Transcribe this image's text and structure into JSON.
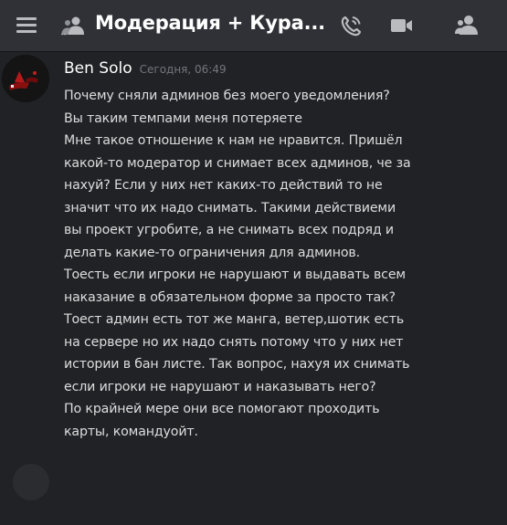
{
  "header": {
    "channel_name": "Модерация + Кура...",
    "icons": {
      "menu": "hamburger-menu-icon",
      "channel": "group-members-icon",
      "call": "phone-call-icon",
      "video": "video-camera-icon",
      "members": "member-list-icon"
    }
  },
  "message": {
    "author": "Ben Solo",
    "timestamp": "Сегодня, 06:49",
    "lines": [
      "Почему сняли админов без моего уведомления?",
      "Вы таким темпами меня потеряете",
      "Мне такое отношение к нам не нравится. Пришёл",
      "какой-то модератор и снимает всех админов, че за",
      "нахуй? Если у них нет каких-то действий то не",
      "значит что их надо снимать.  Такими действиеми",
      "вы проект угробите, а не снимать всех подряд и",
      "делать какие-то ограничения для админов.",
      "Тоесть если игроки не нарушают и выдавать всем",
      "наказание в обязательном форме за просто так?",
      "Тоест админ есть тот же манга, ветер,шотик есть",
      "на сервере но их надо снять потому что у них нет",
      "истории в бан листе. Так вопрос, нахуя их снимать",
      "если игроки не нарушают и наказывать него?",
      "По крайней мере они все помогают проходить",
      "карты, командуойт."
    ]
  },
  "colors": {
    "background": "#202225",
    "header_background": "#2f3136",
    "author": "#ffffff",
    "text": "#dcddde",
    "timestamp": "#72767d",
    "icon": "#b9bbbe"
  }
}
